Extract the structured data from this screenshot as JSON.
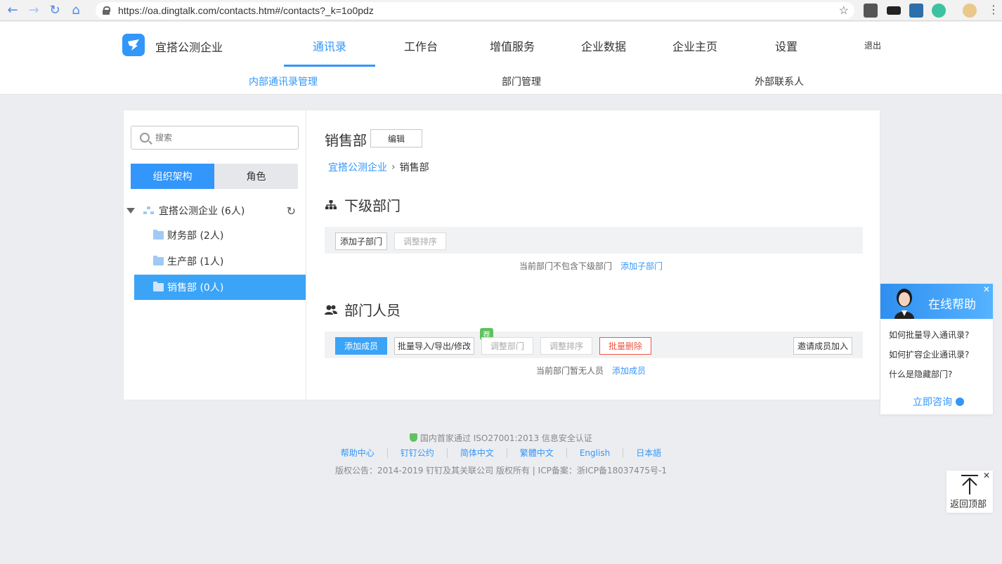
{
  "browser": {
    "url": "https://oa.dingtalk.com/contacts.htm#/contacts?_k=1o0pdz"
  },
  "header": {
    "brand": "宜搭公测企业",
    "nav": [
      "通讯录",
      "工作台",
      "增值服务",
      "企业数据",
      "企业主页",
      "设置"
    ],
    "logout": "退出",
    "subnav": [
      "内部通讯录管理",
      "部门管理",
      "外部联系人"
    ]
  },
  "sidebar": {
    "search_placeholder": "搜索",
    "seg_org": "组织架构",
    "seg_role": "角色",
    "root": "宜搭公测企业 (6人)",
    "items": [
      "财务部 (2人)",
      "生产部 (1人)",
      "销售部 (0人)"
    ]
  },
  "content": {
    "title": "销售部",
    "edit": "编辑",
    "crumb_root": "宜搭公测企业",
    "crumb_current": "销售部",
    "sub_title": "下级部门",
    "sub_add": "添加子部门",
    "sub_sort": "调整排序",
    "sub_empty": "当前部门不包含下级部门",
    "sub_empty_link": "添加子部门",
    "member_title": "部门人员",
    "add_member": "添加成员",
    "bulk": "批量导入/导出/修改",
    "badge": "荐",
    "adjust_dept": "调整部门",
    "adjust_sort": "调整排序",
    "bulk_delete": "批量删除",
    "invite": "邀请成员加入",
    "member_empty": "当前部门暂无人员",
    "member_empty_link": "添加成员"
  },
  "footer": {
    "cert": "国内首家通过 ISO27001:2013 信息安全认证",
    "links": [
      "帮助中心",
      "钉钉公约",
      "简体中文",
      "繁體中文",
      "English",
      "日本語"
    ],
    "copyright": "版权公告：2014-2019 钉钉及其关联公司 版权所有 | ICP备案：浙ICP备18037475号-1"
  },
  "help": {
    "title": "在线帮助",
    "questions": [
      "如何批量导入通讯录?",
      "如何扩容企业通讯录?",
      "什么是隐藏部门?"
    ],
    "cta": "立即咨询"
  },
  "totop": {
    "label": "返回顶部"
  },
  "colors": {
    "accent": "#3296fa",
    "danger": "#f25643",
    "badge": "#5fc260"
  }
}
